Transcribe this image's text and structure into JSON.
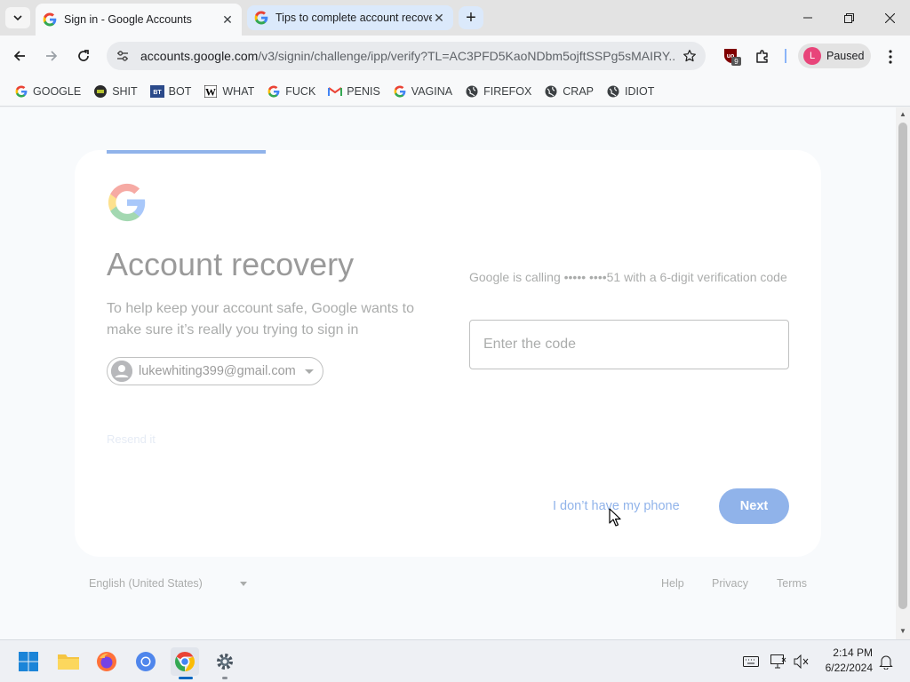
{
  "browser": {
    "tabs": [
      {
        "title": "Sign in - Google Accounts",
        "active": true
      },
      {
        "title": "Tips to complete account recovery",
        "active": false
      }
    ],
    "address": {
      "host": "accounts.google.com",
      "path": "/v3/signin/challenge/ipp/verify?TL=AC3PFD5KaoNDbm5ojftSSPg5sMAIRY..."
    },
    "extension_badge": "9",
    "profile": {
      "initial": "L",
      "status": "Paused",
      "color": "#e8457a"
    },
    "bookmarks": [
      {
        "label": "GOOGLE",
        "icon": "google-g-icon"
      },
      {
        "label": "SHIT",
        "icon": "site-icon"
      },
      {
        "label": "BOT",
        "icon": "bt-icon"
      },
      {
        "label": "WHAT",
        "icon": "w-icon"
      },
      {
        "label": "FUCK",
        "icon": "google-g-icon"
      },
      {
        "label": "PENIS",
        "icon": "gmail-icon"
      },
      {
        "label": "VAGINA",
        "icon": "google-g-icon"
      },
      {
        "label": "FIREFOX",
        "icon": "globe-icon"
      },
      {
        "label": "CRAP",
        "icon": "globe-icon"
      },
      {
        "label": "IDIOT",
        "icon": "globe-icon"
      }
    ]
  },
  "page": {
    "heading": "Account recovery",
    "subtext": "To help keep your account safe, Google wants to make sure it’s really you trying to sign in",
    "account_email": "lukewhiting399@gmail.com",
    "resend_label": "Resend it",
    "info": "Google is calling ••••• ••••51 with a 6-digit verification code",
    "code_placeholder": "Enter the code",
    "no_phone_label": "I don’t have my phone",
    "next_label": "Next",
    "accent": "#0b57d0"
  },
  "footer": {
    "language": "English (United States)",
    "links": [
      "Help",
      "Privacy",
      "Terms"
    ]
  },
  "taskbar": {
    "time": "2:14 PM",
    "date": "6/22/2024"
  }
}
